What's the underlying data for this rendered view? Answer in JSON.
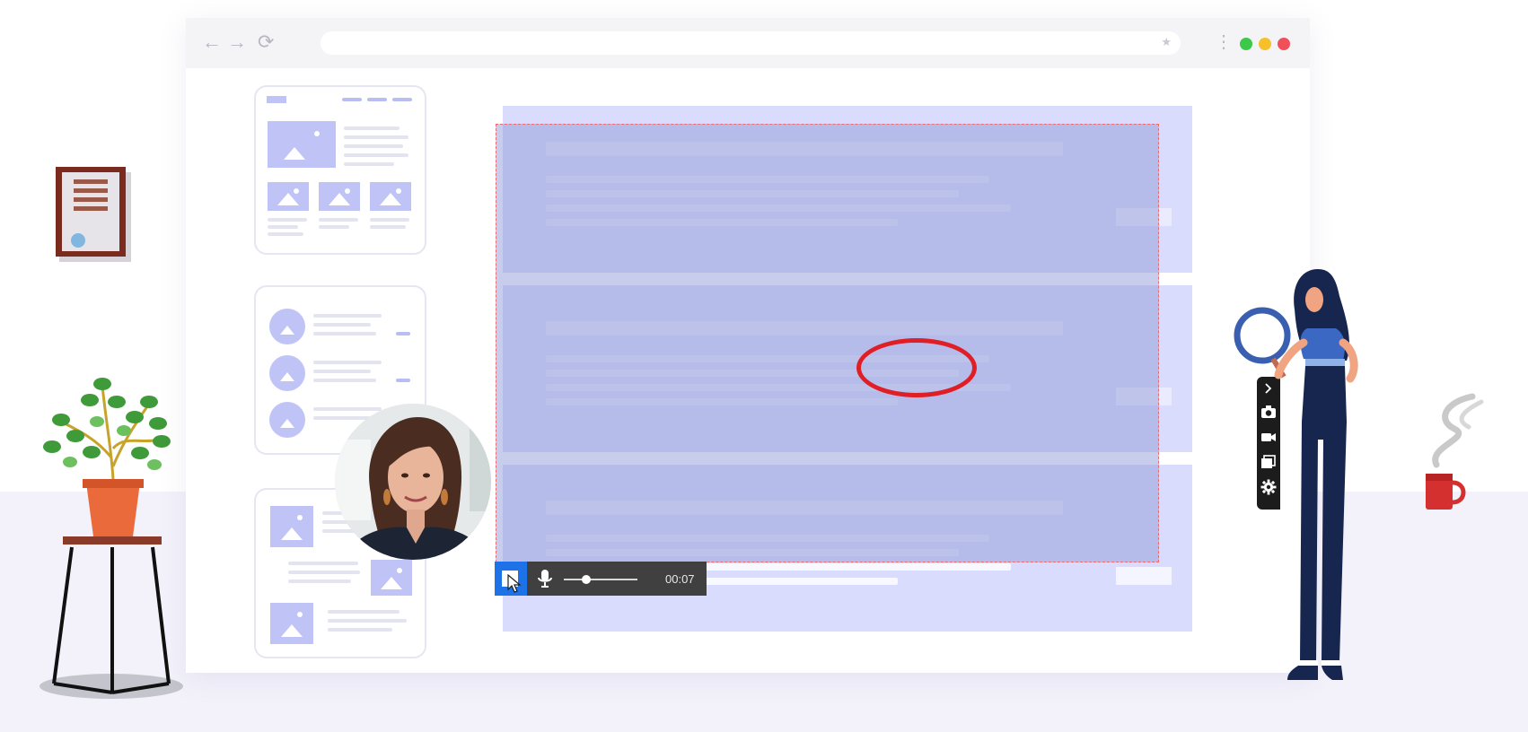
{
  "browser": {
    "nav": {
      "back_icon": "←",
      "forward_icon": "→",
      "reload_icon": "⟳",
      "bookmark_icon": "★",
      "menu_icon": "⋮"
    },
    "window_controls": {
      "colors": [
        "#3cc94a",
        "#f6c02a",
        "#f0505a"
      ]
    }
  },
  "recording": {
    "elapsed": "00:07",
    "volume_level": 0.3,
    "stop_color": "#1d72e8"
  },
  "annotation": {
    "color": "#e01e25",
    "shape": "ellipse"
  },
  "capture_toolbar": {
    "items": [
      "collapse-arrow-icon",
      "camera-icon",
      "video-icon",
      "window-icon",
      "gear-icon"
    ]
  },
  "illustrations": [
    "framed-certificate",
    "potted-plant-on-stool",
    "webcam-presenter",
    "woman-with-magnifier",
    "coffee-mug"
  ]
}
